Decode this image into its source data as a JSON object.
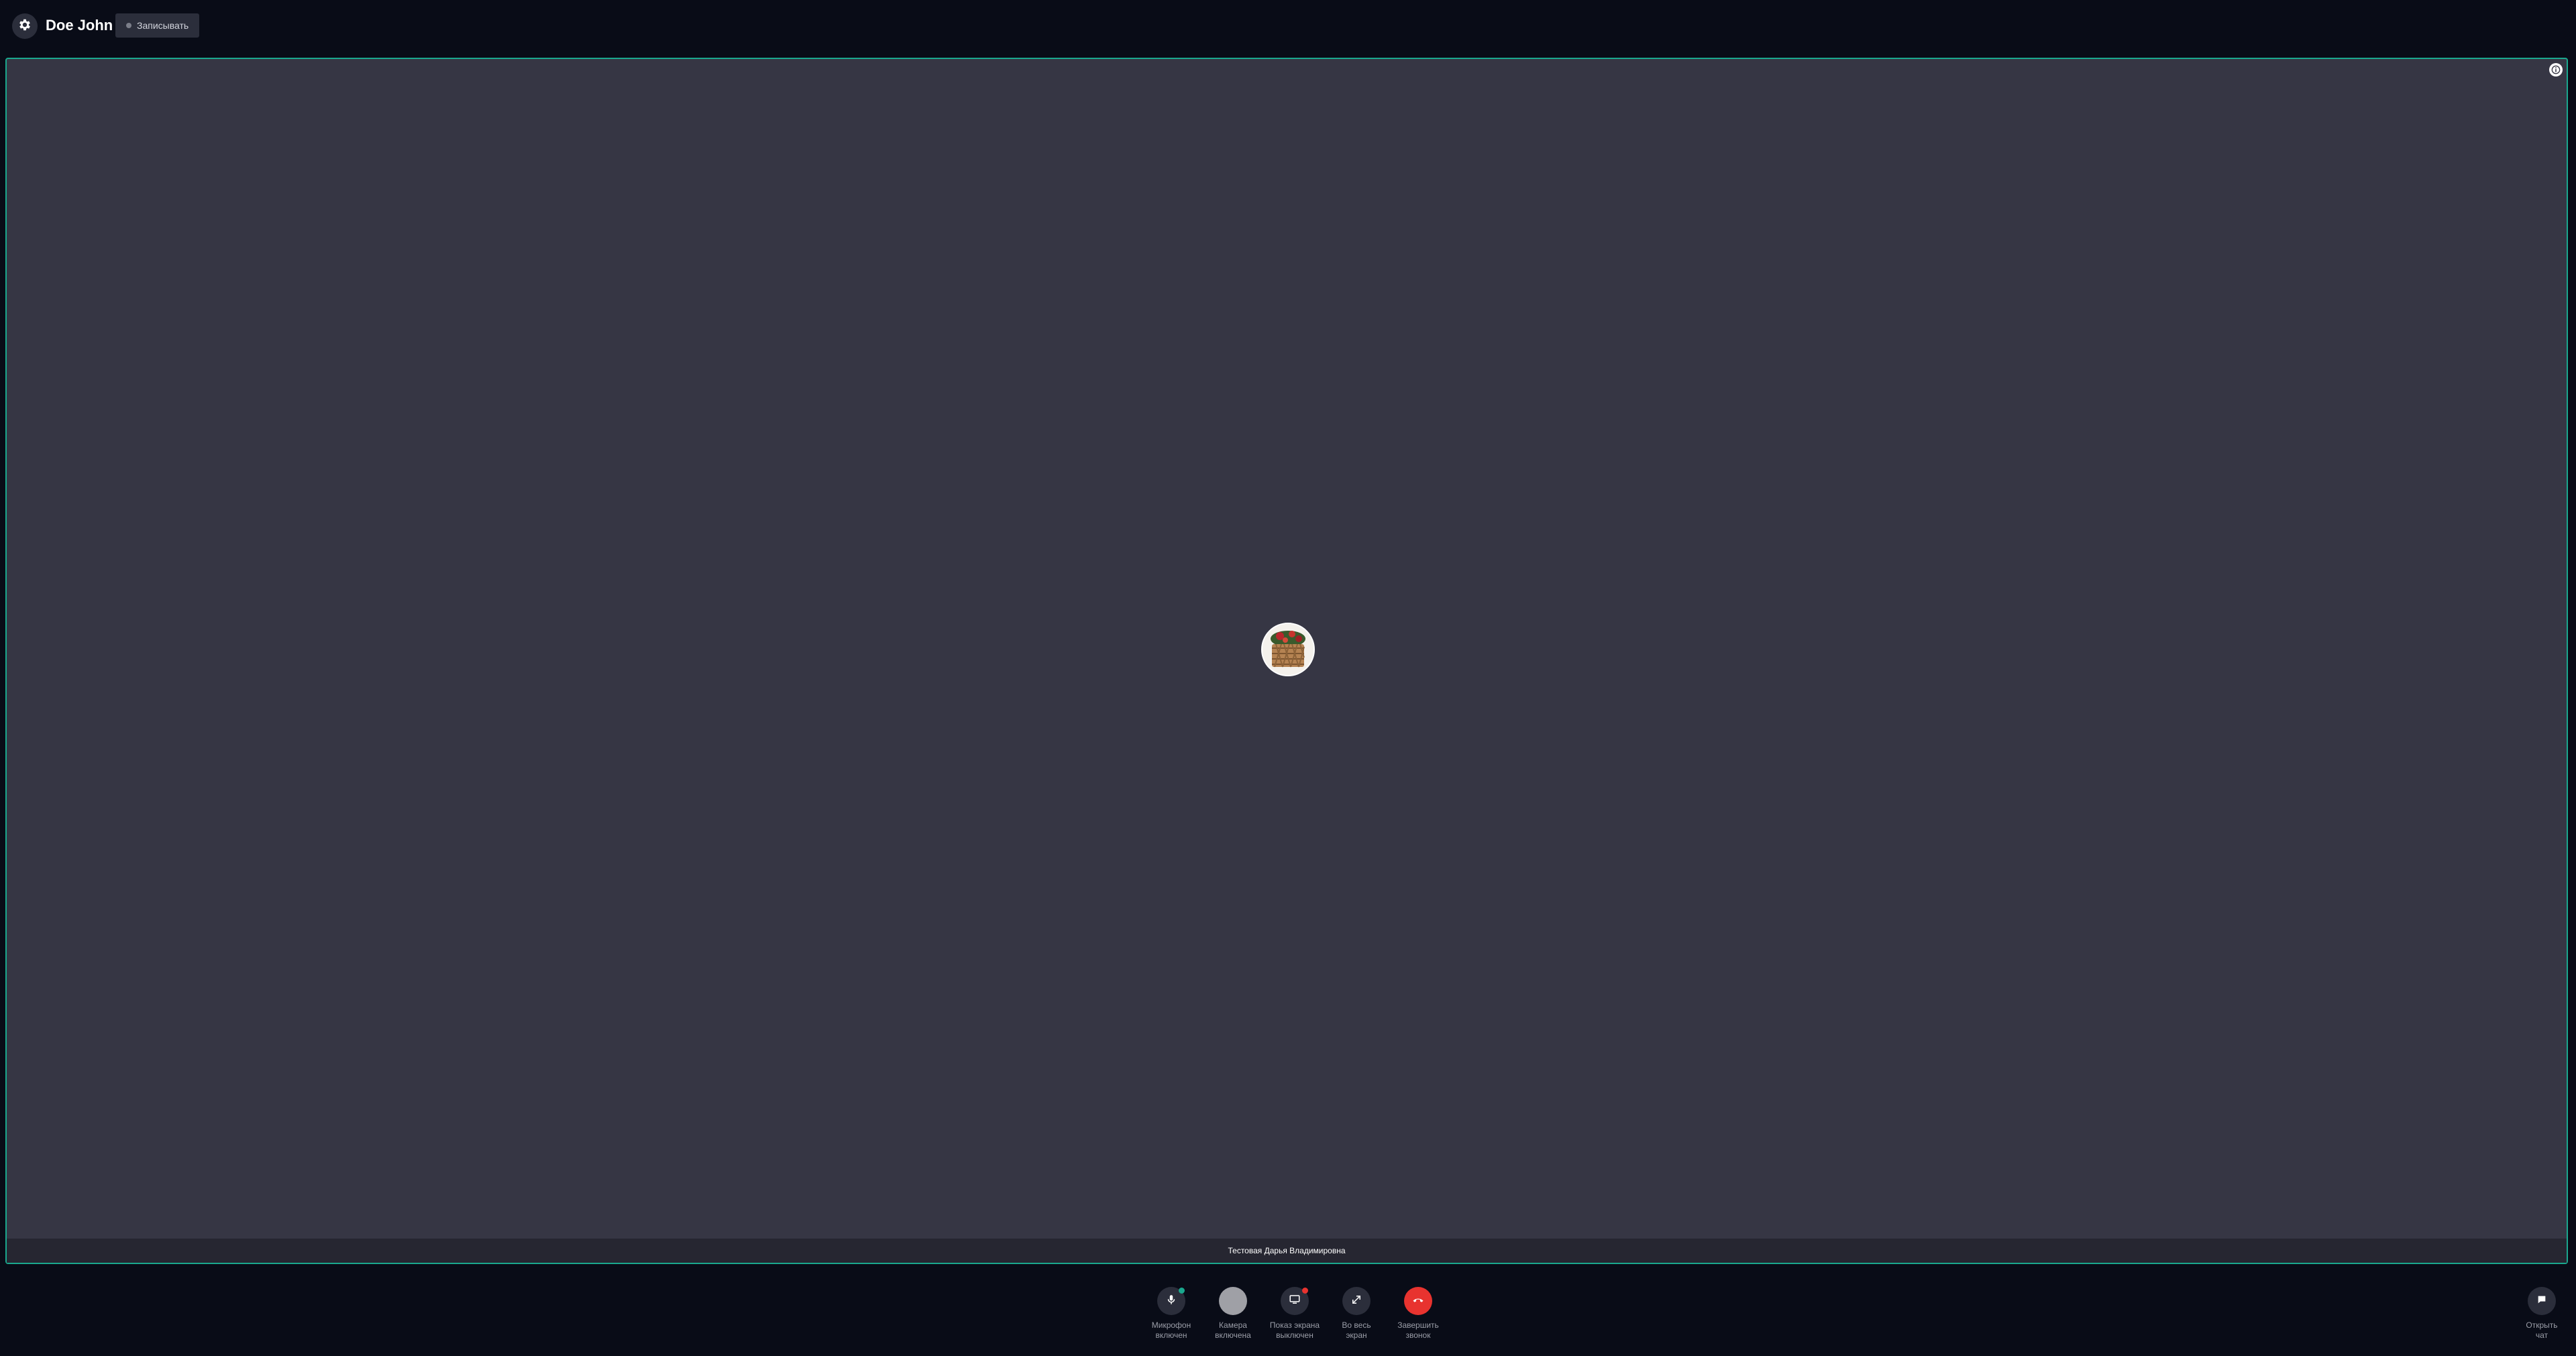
{
  "header": {
    "user_name": "Doe John",
    "record_label": "Записывать",
    "settings_icon": "gear-icon"
  },
  "stage": {
    "participant_name": "Тестовая Дарья Владимировна",
    "info_icon": "info-icon",
    "border_color": "#1aa88e"
  },
  "controls": [
    {
      "id": "mic",
      "line1": "Микрофон",
      "line2": "включен",
      "icon": "microphone-icon",
      "badge_color": "#1aa88e"
    },
    {
      "id": "camera",
      "line1": "Камера",
      "line2": "включена",
      "icon": "camera-icon"
    },
    {
      "id": "screen",
      "line1": "Показ экрана",
      "line2": "выключен",
      "icon": "screen-share-icon",
      "badge_color": "#e8332f"
    },
    {
      "id": "fullscreen",
      "line1": "Во весь",
      "line2": "экран",
      "icon": "expand-icon"
    },
    {
      "id": "hangup",
      "line1": "Завершить",
      "line2": "звонок",
      "icon": "hang-up-icon",
      "color": "#e8332f"
    }
  ],
  "chat": {
    "line1": "Открыть",
    "line2": "чат",
    "icon": "chat-icon"
  }
}
